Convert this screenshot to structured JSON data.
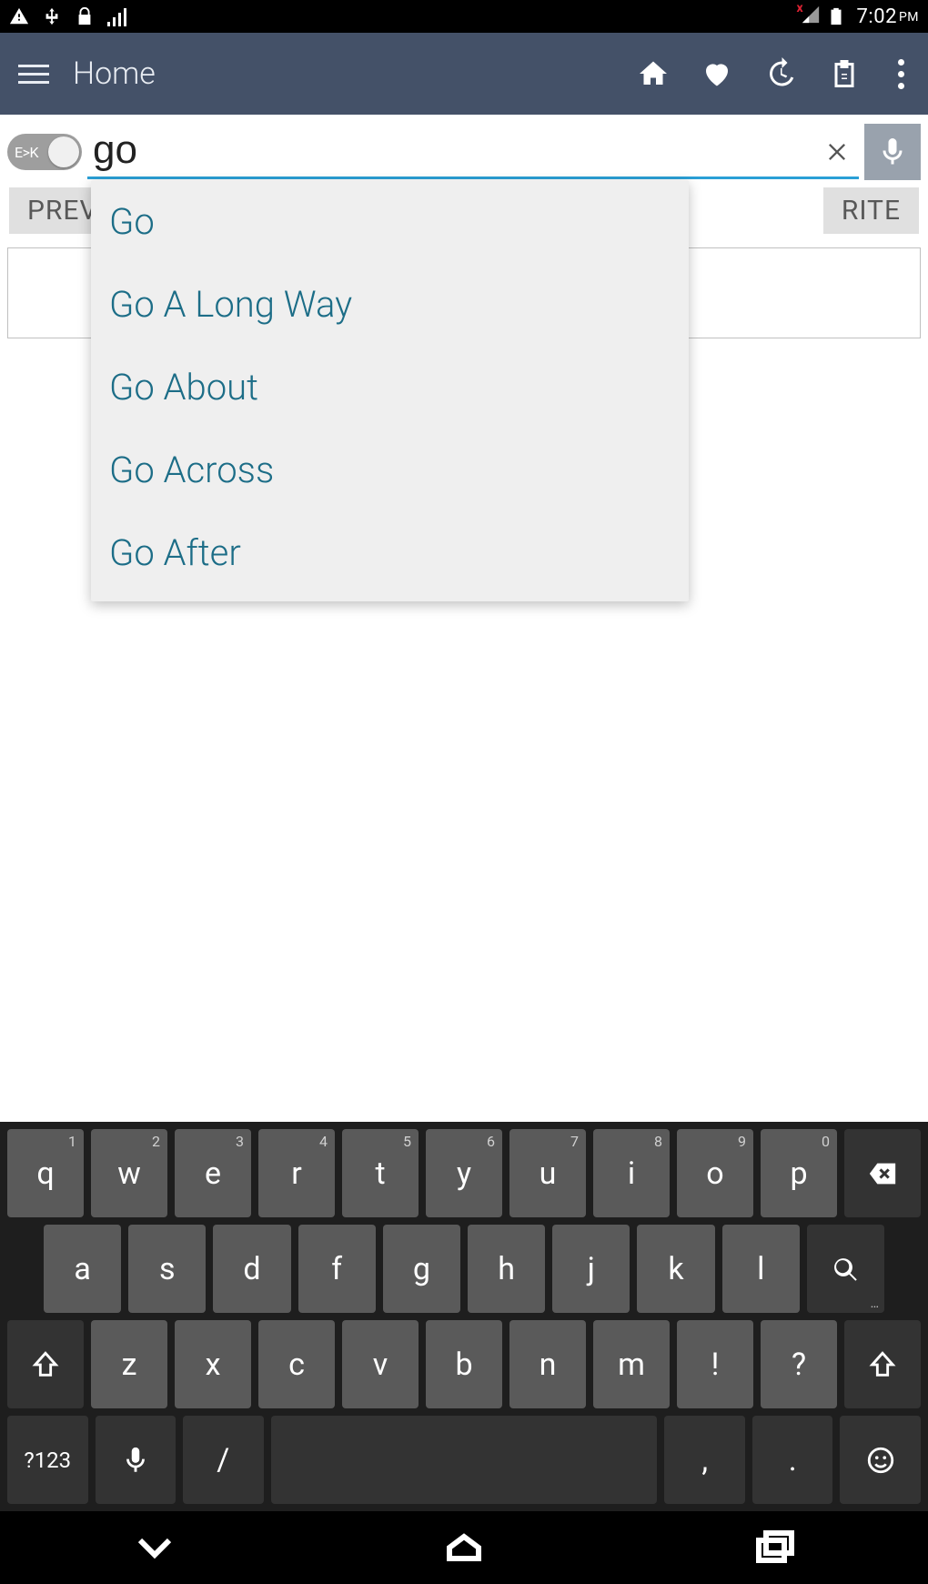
{
  "status": {
    "clock": "7:02",
    "ampm": "PM"
  },
  "appbar": {
    "title": "Home"
  },
  "search": {
    "toggle_label": "E>K",
    "value": "go"
  },
  "tabs": {
    "left": "PREV",
    "right": "RITE"
  },
  "suggestions": [
    "Go",
    "Go A Long Way",
    "Go About",
    "Go Across",
    "Go After"
  ],
  "keyboard": {
    "row1": [
      {
        "k": "q",
        "s": "1"
      },
      {
        "k": "w",
        "s": "2"
      },
      {
        "k": "e",
        "s": "3"
      },
      {
        "k": "r",
        "s": "4"
      },
      {
        "k": "t",
        "s": "5"
      },
      {
        "k": "y",
        "s": "6"
      },
      {
        "k": "u",
        "s": "7"
      },
      {
        "k": "i",
        "s": "8"
      },
      {
        "k": "o",
        "s": "9"
      },
      {
        "k": "p",
        "s": "0"
      }
    ],
    "row2": [
      {
        "k": "a"
      },
      {
        "k": "s"
      },
      {
        "k": "d"
      },
      {
        "k": "f"
      },
      {
        "k": "g"
      },
      {
        "k": "h"
      },
      {
        "k": "j"
      },
      {
        "k": "k"
      },
      {
        "k": "l"
      }
    ],
    "row3": [
      {
        "k": "z"
      },
      {
        "k": "x"
      },
      {
        "k": "c"
      },
      {
        "k": "v"
      },
      {
        "k": "b"
      },
      {
        "k": "n"
      },
      {
        "k": "m"
      },
      {
        "k": "!"
      },
      {
        "k": "?"
      }
    ],
    "row4": {
      "sym": "?123",
      "slash": "/",
      "comma": ",",
      "period": "."
    }
  }
}
